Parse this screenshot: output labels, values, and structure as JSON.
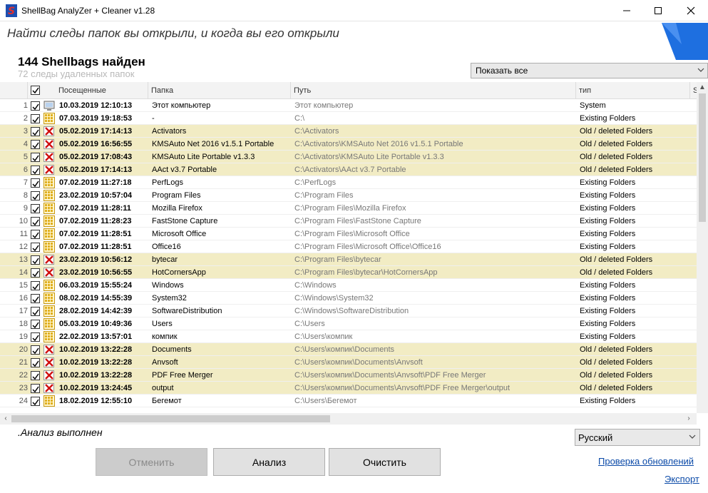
{
  "window": {
    "title": "ShellBag  AnalyZer + Cleaner v1.28"
  },
  "header": {
    "subtitle": "Найти следы папок вы открыли, и когда вы его открыли",
    "found_title": "144 Shellbags найден",
    "found_count": "72  следы удаленных папок",
    "filter_value": "Показать все"
  },
  "grid": {
    "columns": {
      "visited": "Посещенные",
      "folder": "Папка",
      "path": "Путь",
      "type": "тип",
      "extra": "S"
    },
    "rows": [
      {
        "num": "1",
        "icon": "computer-icon",
        "date": "10.03.2019 12:10:13",
        "folder": "Этот компьютер",
        "path": "Этот компьютер",
        "type": "System"
      },
      {
        "num": "2",
        "icon": "folder-grid-icon",
        "date": "07.03.2019 19:18:53",
        "folder": "-",
        "path": "C:\\",
        "type": "Existing Folders"
      },
      {
        "num": "3",
        "icon": "deleted-x-icon",
        "date": "05.02.2019 17:14:13",
        "folder": "Activators",
        "path": "C:\\Activators",
        "type": "Old / deleted Folders"
      },
      {
        "num": "4",
        "icon": "deleted-x-icon",
        "date": "05.02.2019 16:56:55",
        "folder": "KMSAuto Net 2016 v1.5.1 Portable",
        "path": "C:\\Activators\\KMSAuto Net 2016 v1.5.1 Portable",
        "type": "Old / deleted Folders"
      },
      {
        "num": "5",
        "icon": "deleted-x-icon",
        "date": "05.02.2019 17:08:43",
        "folder": "KMSAuto Lite Portable v1.3.3",
        "path": "C:\\Activators\\KMSAuto Lite Portable v1.3.3",
        "type": "Old / deleted Folders"
      },
      {
        "num": "6",
        "icon": "deleted-x-icon",
        "date": "05.02.2019 17:14:13",
        "folder": "AAct v3.7 Portable",
        "path": "C:\\Activators\\AAct v3.7 Portable",
        "type": "Old / deleted Folders"
      },
      {
        "num": "7",
        "icon": "folder-grid-icon",
        "date": "07.02.2019 11:27:18",
        "folder": "PerfLogs",
        "path": "C:\\PerfLogs",
        "type": "Existing Folders"
      },
      {
        "num": "8",
        "icon": "folder-grid-icon",
        "date": "23.02.2019 10:57:04",
        "folder": "Program Files",
        "path": "C:\\Program Files",
        "type": "Existing Folders"
      },
      {
        "num": "9",
        "icon": "folder-grid-icon",
        "date": "07.02.2019 11:28:11",
        "folder": "Mozilla Firefox",
        "path": "C:\\Program Files\\Mozilla Firefox",
        "type": "Existing Folders"
      },
      {
        "num": "10",
        "icon": "folder-grid-icon",
        "date": "07.02.2019 11:28:23",
        "folder": "FastStone Capture",
        "path": "C:\\Program Files\\FastStone Capture",
        "type": "Existing Folders"
      },
      {
        "num": "11",
        "icon": "folder-grid-icon",
        "date": "07.02.2019 11:28:51",
        "folder": "Microsoft Office",
        "path": "C:\\Program Files\\Microsoft Office",
        "type": "Existing Folders"
      },
      {
        "num": "12",
        "icon": "folder-grid-icon",
        "date": "07.02.2019 11:28:51",
        "folder": "Office16",
        "path": "C:\\Program Files\\Microsoft Office\\Office16",
        "type": "Existing Folders"
      },
      {
        "num": "13",
        "icon": "deleted-x-icon",
        "date": "23.02.2019 10:56:12",
        "folder": "bytecar",
        "path": "C:\\Program Files\\bytecar",
        "type": "Old / deleted Folders"
      },
      {
        "num": "14",
        "icon": "deleted-x-icon",
        "date": "23.02.2019 10:56:55",
        "folder": "HotCornersApp",
        "path": "C:\\Program Files\\bytecar\\HotCornersApp",
        "type": "Old / deleted Folders"
      },
      {
        "num": "15",
        "icon": "folder-grid-icon",
        "date": "06.03.2019 15:55:24",
        "folder": "Windows",
        "path": "C:\\Windows",
        "type": "Existing Folders"
      },
      {
        "num": "16",
        "icon": "folder-grid-icon",
        "date": "08.02.2019 14:55:39",
        "folder": "System32",
        "path": "C:\\Windows\\System32",
        "type": "Existing Folders"
      },
      {
        "num": "17",
        "icon": "folder-grid-icon",
        "date": "28.02.2019 14:42:39",
        "folder": "SoftwareDistribution",
        "path": "C:\\Windows\\SoftwareDistribution",
        "type": "Existing Folders"
      },
      {
        "num": "18",
        "icon": "folder-grid-icon",
        "date": "05.03.2019 10:49:36",
        "folder": "Users",
        "path": "C:\\Users",
        "type": "Existing Folders"
      },
      {
        "num": "19",
        "icon": "folder-grid-icon",
        "date": "22.02.2019 13:57:01",
        "folder": "компик",
        "path": "C:\\Users\\компик",
        "type": "Existing Folders"
      },
      {
        "num": "20",
        "icon": "deleted-x-icon",
        "date": "10.02.2019 13:22:28",
        "folder": "Documents",
        "path": "C:\\Users\\компик\\Documents",
        "type": "Old / deleted Folders"
      },
      {
        "num": "21",
        "icon": "deleted-x-icon",
        "date": "10.02.2019 13:22:28",
        "folder": "Anvsoft",
        "path": "C:\\Users\\компик\\Documents\\Anvsoft",
        "type": "Old / deleted Folders"
      },
      {
        "num": "22",
        "icon": "deleted-x-icon",
        "date": "10.02.2019 13:22:28",
        "folder": "PDF Free Merger",
        "path": "C:\\Users\\компик\\Documents\\Anvsoft\\PDF Free Merger",
        "type": "Old / deleted Folders"
      },
      {
        "num": "23",
        "icon": "deleted-x-icon",
        "date": "10.02.2019 13:24:45",
        "folder": "output",
        "path": "C:\\Users\\компик\\Documents\\Anvsoft\\PDF Free Merger\\output",
        "type": "Old / deleted Folders"
      },
      {
        "num": "24",
        "icon": "folder-grid-icon",
        "date": "18.02.2019 12:55:10",
        "folder": "Бегемот",
        "path": "C:\\Users\\Бегемот",
        "type": "Existing Folders"
      }
    ]
  },
  "footer": {
    "status": ".Анализ выполнен",
    "language": "Русский",
    "cancel_label": "Отменить",
    "analyze_label": "Анализ",
    "clean_label": "Очистить",
    "update_link": "Проверка обновлений",
    "export_link": "Экспорт"
  },
  "colors": {
    "deleted_row": "#f2ecc4",
    "link": "#0b4aa8",
    "accent_blue": "#1e6fe0",
    "deleted_icon": "#d01010",
    "folder_icon": "#e0b020"
  }
}
